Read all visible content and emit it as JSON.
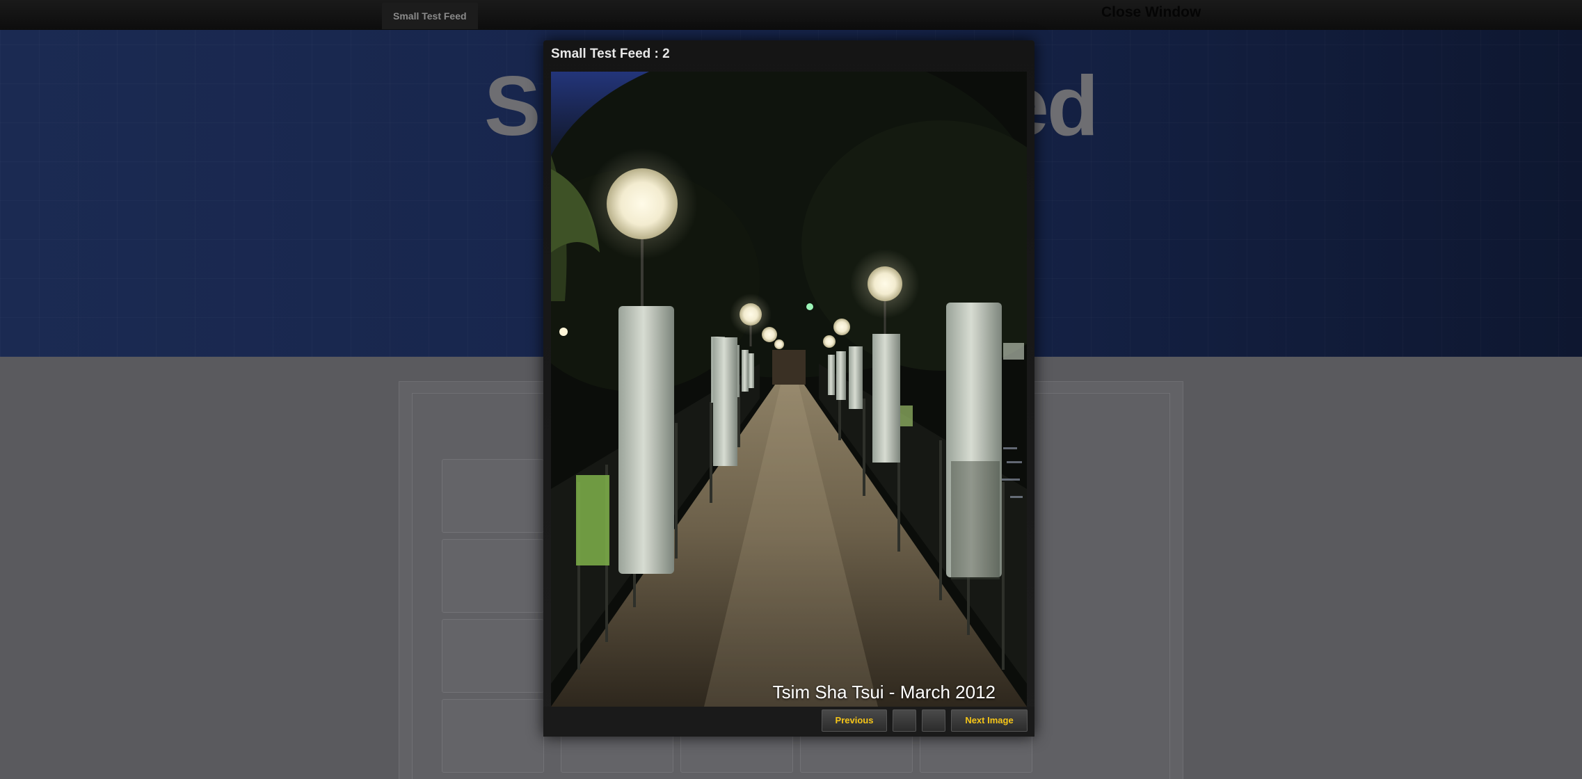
{
  "top_bar": {
    "tab_label": "Small Test Feed",
    "close_label": "Close Window"
  },
  "background_page": {
    "title_fragment_left": "S",
    "title_fragment_right": "ed"
  },
  "lightbox": {
    "title": "Small Test Feed : 2",
    "caption": "Tsim Sha Tsui - March 2012",
    "buttons": {
      "previous": "Previous",
      "next": "Next Image"
    },
    "accent_color": "#f5c518"
  }
}
